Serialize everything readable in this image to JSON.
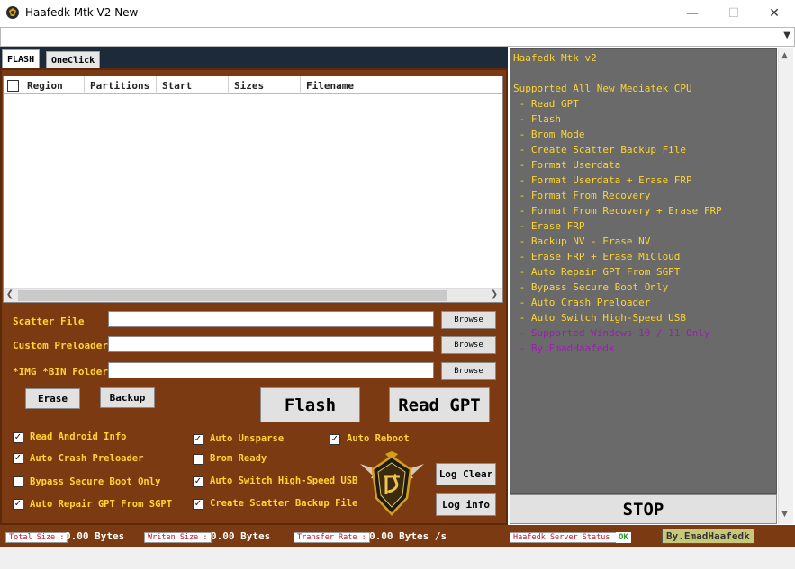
{
  "window": {
    "title": "Haafedk Mtk V2 New",
    "minimize_icon": "—",
    "maximize_icon": "☐",
    "close_icon": "✕"
  },
  "tabs": [
    {
      "label": "FLASH",
      "active": true
    },
    {
      "label": "OneClick",
      "active": false
    }
  ],
  "grid": {
    "columns": [
      "Region",
      "Partitions",
      "Start",
      "Sizes",
      "Filename"
    ]
  },
  "fields": {
    "scatter": {
      "label": "Scatter File",
      "value": "",
      "button": "Browse"
    },
    "preloader": {
      "label": "Custom Preloader",
      "value": "",
      "button": "Browse"
    },
    "img_folder": {
      "label": "*IMG *BIN Folder",
      "value": "",
      "button": "Browse"
    }
  },
  "buttons": {
    "erase": "Erase",
    "backup": "Backup",
    "flash": "Flash",
    "read_gpt": "Read GPT",
    "log_clear": "Log Clear",
    "log_info": "Log info",
    "stop": "STOP"
  },
  "options": [
    {
      "label": "Read Android Info",
      "checked": true
    },
    {
      "label": "Auto Crash Preloader",
      "checked": true
    },
    {
      "label": "Bypass Secure Boot Only",
      "checked": false
    },
    {
      "label": "Auto Repair GPT From SGPT",
      "checked": true
    },
    {
      "label": "Auto Unsparse",
      "checked": true
    },
    {
      "label": "Brom Ready",
      "checked": false
    },
    {
      "label": "Auto Switch High-Speed USB",
      "checked": true
    },
    {
      "label": "Create Scatter Backup File",
      "checked": true
    },
    {
      "label": "Auto Reboot",
      "checked": true
    }
  ],
  "log": {
    "lines": [
      {
        "text": "Haafedk Mtk v2",
        "color": "yellow"
      },
      {
        "text": "",
        "color": "yellow"
      },
      {
        "text": "Supported All New Mediatek CPU",
        "color": "yellow"
      },
      {
        "text": " - Read GPT",
        "color": "yellow"
      },
      {
        "text": " - Flash",
        "color": "yellow"
      },
      {
        "text": " - Brom Mode",
        "color": "yellow"
      },
      {
        "text": " - Create Scatter Backup File",
        "color": "yellow"
      },
      {
        "text": " - Format Userdata",
        "color": "yellow"
      },
      {
        "text": " - Format Userdata + Erase FRP",
        "color": "yellow"
      },
      {
        "text": " - Format From Recovery",
        "color": "yellow"
      },
      {
        "text": " - Format From Recovery + Erase FRP",
        "color": "yellow"
      },
      {
        "text": " - Erase FRP",
        "color": "yellow"
      },
      {
        "text": " - Backup NV - Erase NV",
        "color": "yellow"
      },
      {
        "text": " - Erase FRP + Erase MiCloud",
        "color": "yellow"
      },
      {
        "text": " - Auto Repair GPT From SGPT",
        "color": "yellow"
      },
      {
        "text": " - Bypass Secure Boot Only",
        "color": "yellow"
      },
      {
        "text": " - Auto Crash Preloader",
        "color": "yellow"
      },
      {
        "text": " - Auto Switch High-Speed USB",
        "color": "yellow"
      },
      {
        "text": " - Supported Windows 10 / 11 Only",
        "color": "purple"
      },
      {
        "text": " - By.EmadHaafedk",
        "color": "purple"
      }
    ]
  },
  "status": {
    "total_size_label": "Total Size :",
    "total_size_value": "0.00 Bytes",
    "written_size_label": "Writen Size :",
    "written_size_value": "0.00 Bytes",
    "transfer_rate_label": "Transfer Rate :",
    "transfer_rate_value": "0.00 Bytes /s",
    "server_label": "Haafedk Server Status :",
    "server_value": "OK",
    "credit": "By.EmadHaafedk"
  },
  "colors": {
    "panel_brown": "#7b3a12",
    "label_yellow": "#ffd52e",
    "log_purple": "#a01bb4",
    "log_bg": "#6a6a6a"
  }
}
